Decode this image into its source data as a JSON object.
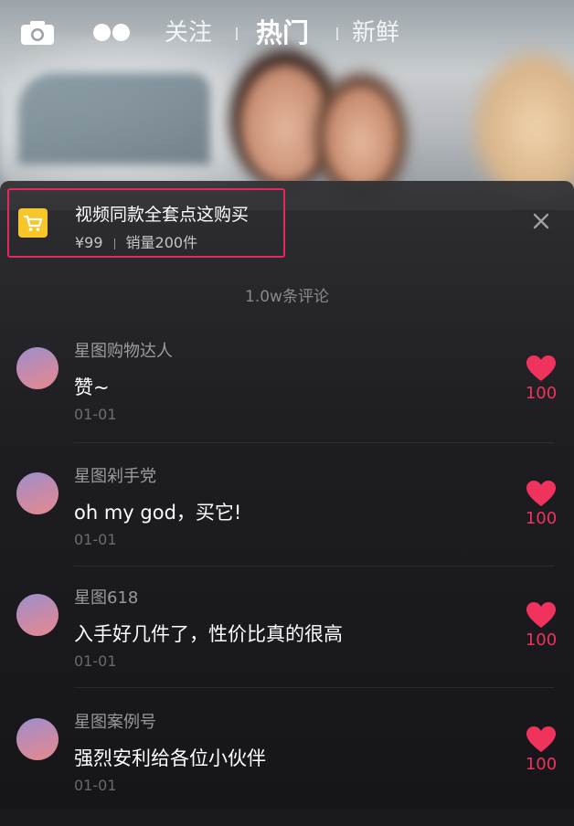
{
  "nav": {
    "tabs": [
      {
        "label": "关注"
      },
      {
        "label": "热门",
        "active": true
      },
      {
        "label": "新鲜"
      }
    ],
    "icons": [
      "camera-icon",
      "dots-icon"
    ]
  },
  "product": {
    "title": "视频同款全套点这购买",
    "price": "¥99",
    "sales": "销量200件",
    "icon": "cart-icon",
    "accent": "#e8285a"
  },
  "comments_header": "1.0w条评论",
  "comments": [
    {
      "user": "星图购物达人",
      "text": "赞~",
      "date": "01-01",
      "likes": "100"
    },
    {
      "user": "星图剁手党",
      "text": "oh my god，买它!",
      "date": "01-01",
      "likes": "100"
    },
    {
      "user": "星图618",
      "text": "入手好几件了，性价比真的很高",
      "date": "01-01",
      "likes": "100"
    },
    {
      "user": "星图案例号",
      "text": "强烈安利给各位小伙伴",
      "date": "01-01",
      "likes": "100"
    }
  ],
  "colors": {
    "like": "#f0335d",
    "cart_badge": "#f7c72a"
  }
}
